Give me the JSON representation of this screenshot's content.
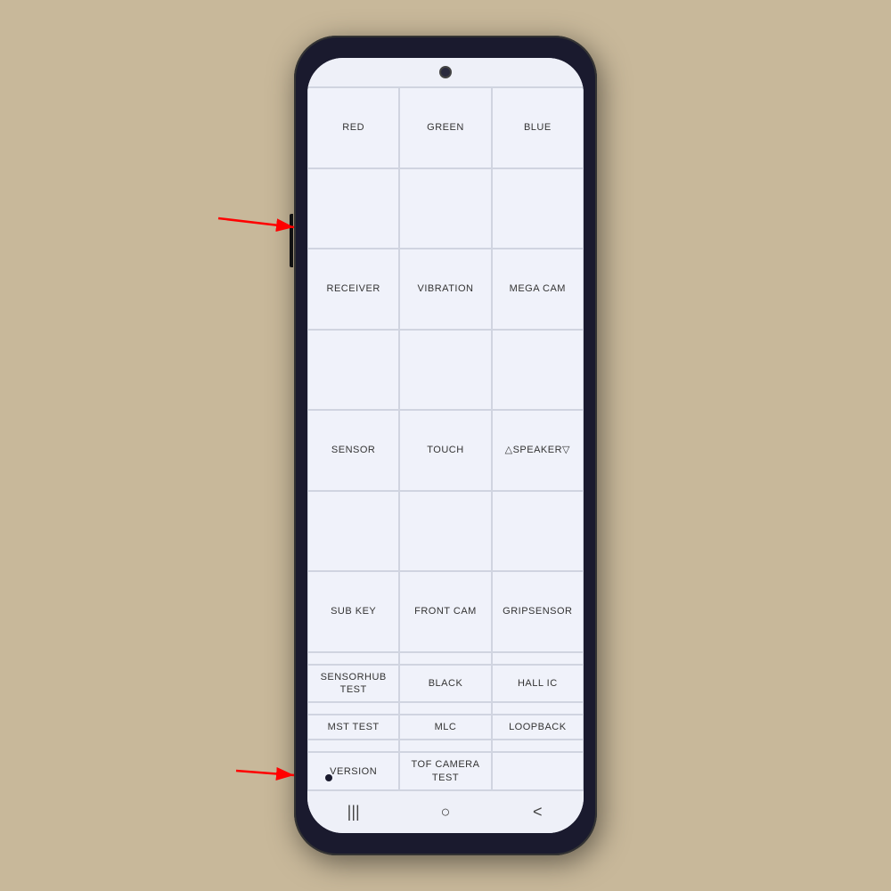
{
  "phone": {
    "grid": [
      {
        "label": "RED"
      },
      {
        "label": "GREEN"
      },
      {
        "label": "BLUE"
      },
      {
        "label": ""
      },
      {
        "label": ""
      },
      {
        "label": ""
      },
      {
        "label": "RECEIVER"
      },
      {
        "label": "VIBRATION"
      },
      {
        "label": "MEGA CAM"
      },
      {
        "label": ""
      },
      {
        "label": ""
      },
      {
        "label": ""
      },
      {
        "label": "SENSOR"
      },
      {
        "label": "TOUCH"
      },
      {
        "label": "△SPEAKER▽"
      },
      {
        "label": ""
      },
      {
        "label": ""
      },
      {
        "label": ""
      },
      {
        "label": "SUB KEY"
      },
      {
        "label": "FRONT CAM"
      },
      {
        "label": "GRIPSENSOR"
      },
      {
        "label": ""
      },
      {
        "label": ""
      },
      {
        "label": ""
      },
      {
        "label": "SENSORHUB TEST"
      },
      {
        "label": "BLACK"
      },
      {
        "label": "HALL IC"
      },
      {
        "label": ""
      },
      {
        "label": ""
      },
      {
        "label": ""
      },
      {
        "label": "MST TEST"
      },
      {
        "label": "MLC"
      },
      {
        "label": "LOOPBACK"
      },
      {
        "label": ""
      },
      {
        "label": ""
      },
      {
        "label": ""
      },
      {
        "label": "VERSION"
      },
      {
        "label": "TOF CAMERA TEST"
      },
      {
        "label": ""
      }
    ],
    "nav": {
      "recent": "|||",
      "home": "○",
      "back": "<"
    }
  }
}
